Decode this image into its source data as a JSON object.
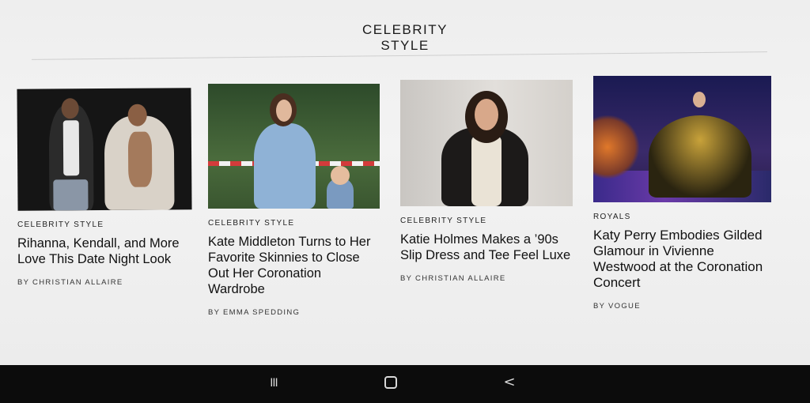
{
  "section": {
    "title_line1": "CELEBRITY",
    "title_line2": "STYLE"
  },
  "cards": [
    {
      "kicker": "CELEBRITY STYLE",
      "headline": "Rihanna, Kendall, and More Love This Date Night Look",
      "byline": "BY CHRISTIAN ALLAIRE"
    },
    {
      "kicker": "CELEBRITY STYLE",
      "headline": "Kate Middleton Turns to Her Favorite Skinnies to Close Out Her Coronation Wardrobe",
      "byline": "BY EMMA SPEDDING"
    },
    {
      "kicker": "CELEBRITY STYLE",
      "headline": "Katie Holmes Makes a ’90s Slip Dress and Tee Feel Luxe",
      "byline": "BY CHRISTIAN ALLAIRE"
    },
    {
      "kicker": "ROYALS",
      "headline": "Katy Perry Embodies Gilded Glamour in Vivienne Westwood at the Coronation Concert",
      "byline": "BY VOGUE"
    }
  ],
  "navbar": {
    "recents_icon": "III",
    "home_icon": "O",
    "back_icon": "<"
  }
}
